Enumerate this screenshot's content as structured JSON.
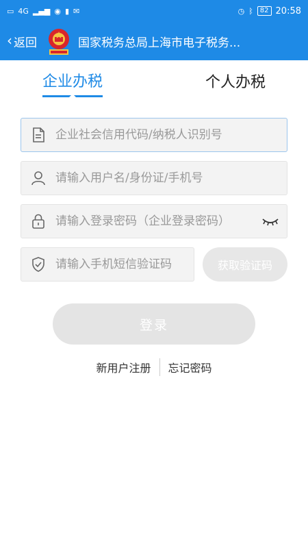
{
  "statusbar": {
    "signal_text": "4G",
    "battery": "82",
    "time": "20:58"
  },
  "navbar": {
    "back_label": "返回",
    "title": "国家税务总局上海市电子税务..."
  },
  "tabs": [
    {
      "label": "企业办税",
      "active": true
    },
    {
      "label": "个人办税",
      "active": false
    }
  ],
  "form": {
    "credit_code_placeholder": "企业社会信用代码/纳税人识别号",
    "username_placeholder": "请输入用户名/身份证/手机号",
    "password_placeholder": "请输入登录密码（企业登录密码）",
    "sms_placeholder": "请输入手机短信验证码",
    "get_code_label": "获取验证码"
  },
  "login_label": "登录",
  "links": {
    "register": "新用户注册",
    "forgot": "忘记密码"
  },
  "colors": {
    "primary": "#1e8ae6",
    "disabled_button": "#e4e4e4"
  }
}
